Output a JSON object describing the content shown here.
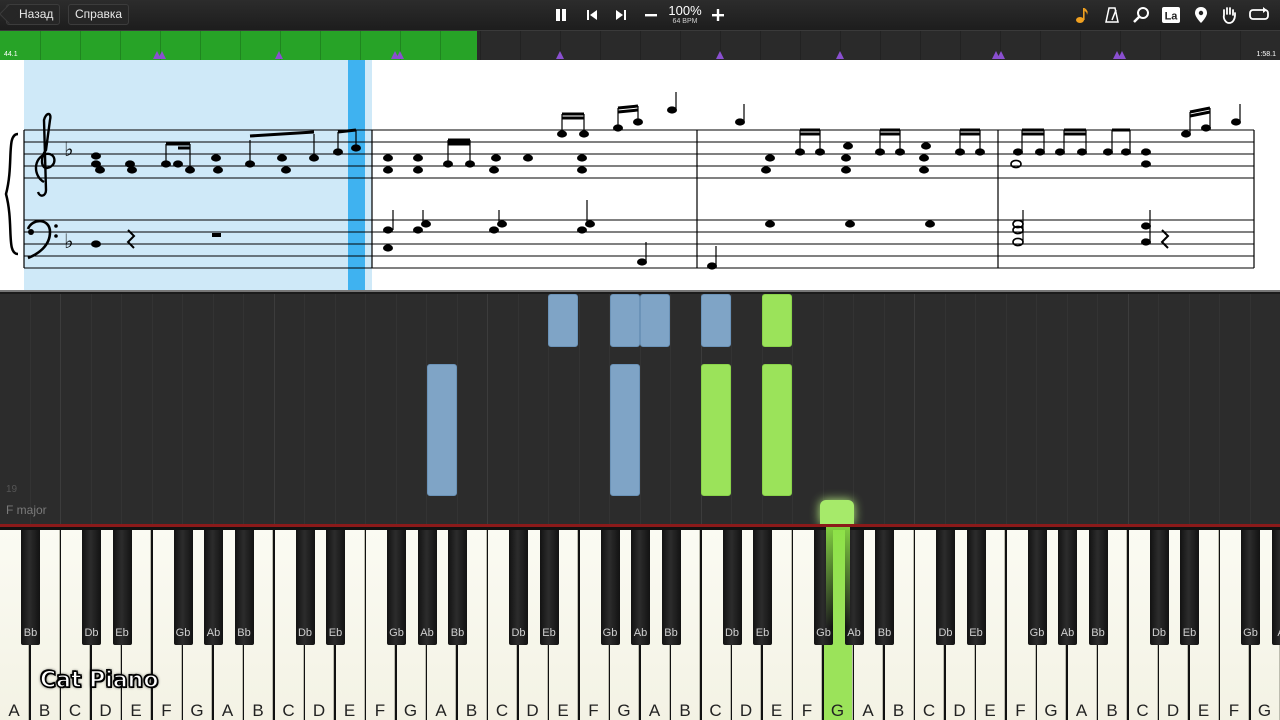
{
  "toolbar": {
    "back_label": "Назад",
    "help_label": "Справка",
    "tempo_percent": "100%",
    "tempo_bpm": "64 BPM",
    "left_controls": [
      "pause-icon",
      "skip-back-icon",
      "skip-forward-icon",
      "minus-icon",
      "plus-icon"
    ],
    "right_icons": [
      "note-icon",
      "metronome-icon",
      "magnifier-icon",
      "label-icon",
      "location-pin-icon",
      "hand-icon",
      "loop-icon"
    ],
    "label_icon_text": "La",
    "accent_color": "#f0a020"
  },
  "timeline": {
    "start_time": "44.1",
    "end_time": "1:58.1",
    "progress": 0.373,
    "played_color": "#27a327",
    "marker_color": "#8a4fd0"
  },
  "sheet": {
    "key_signature": "F major",
    "clefs": [
      "treble-clef-icon",
      "bass-clef-icon"
    ],
    "highlight_color": "#cfe9f8",
    "playhead_color": "#3fb2f0"
  },
  "roll": {
    "bar_number": "19",
    "key_label": "F major",
    "blue_color": "#7fa4c6",
    "green_color": "#9be35a"
  },
  "keyboard": {
    "white_keys": [
      "A",
      "B",
      "C",
      "D",
      "E",
      "F",
      "G",
      "A",
      "B",
      "C",
      "D",
      "E",
      "F",
      "G",
      "A",
      "B",
      "C",
      "D",
      "E",
      "F",
      "G",
      "A",
      "B",
      "C",
      "D",
      "E",
      "F",
      "G",
      "A",
      "B",
      "C",
      "D",
      "E",
      "F",
      "G",
      "A",
      "B",
      "C",
      "D",
      "E",
      "F",
      "G",
      "A"
    ],
    "black_keys": [
      "Bb",
      "Db",
      "Eb",
      "Gb",
      "Ab",
      "Bb",
      "Db",
      "Eb",
      "Gb",
      "Ab",
      "Bb",
      "Db",
      "Eb",
      "Gb",
      "Ab",
      "Bb",
      "Db",
      "Eb",
      "Gb",
      "Ab",
      "Bb",
      "Db",
      "Eb",
      "Gb",
      "Ab",
      "Bb",
      "Db",
      "Eb",
      "Gb",
      "A"
    ],
    "active_key_index": 27
  },
  "watermark": "Cat Piano"
}
